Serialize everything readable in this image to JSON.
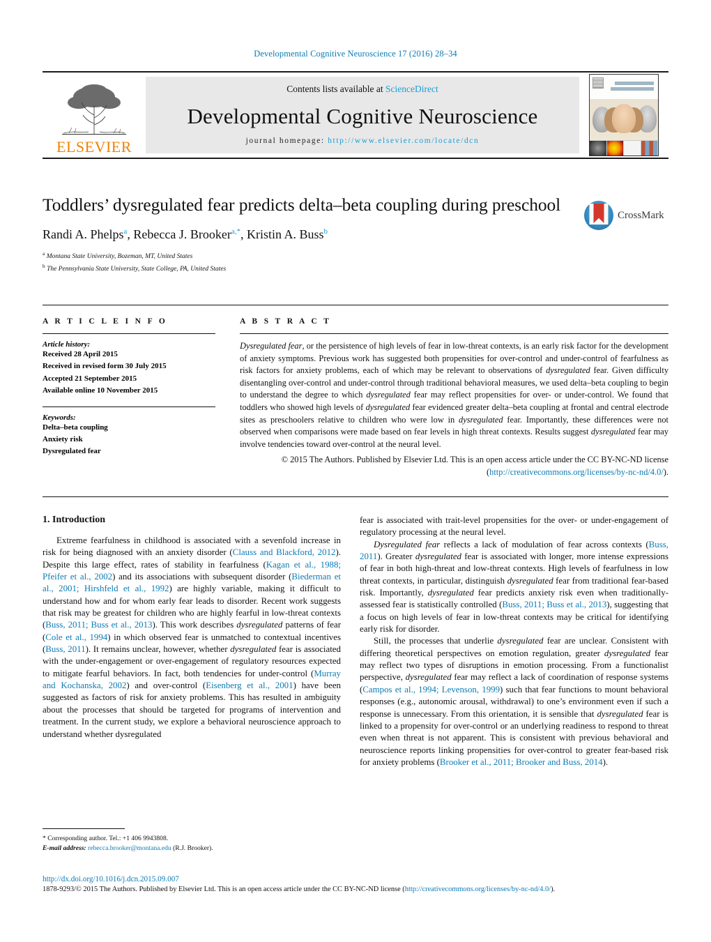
{
  "running_head": "Developmental Cognitive Neuroscience 17 (2016) 28–34",
  "masthead": {
    "publisher_name": "ELSEVIER",
    "contents_prefix": "Contents lists available at ",
    "contents_link": "ScienceDirect",
    "journal_title": "Developmental Cognitive Neuroscience",
    "homepage_prefix": "journal homepage: ",
    "homepage_url": "http://www.elsevier.com/locate/dcn",
    "cover_title_line1": "Developmental",
    "cover_title_line2": "Cognitive Neuroscience"
  },
  "article": {
    "title": "Toddlers’ dysregulated fear predicts delta–beta coupling during preschool",
    "authors_html": "Randi A. Phelps<sup>a</sup>, Rebecca J. Brooker<sup>a,*</sup>, Kristin A. Buss<sup>b</sup>",
    "affiliations": [
      {
        "marker": "a",
        "text": "Montana State University, Bozeman, MT, United States"
      },
      {
        "marker": "b",
        "text": "The Pennsylvania State University, State College, PA, United States"
      }
    ],
    "crossmark_label": "CrossMark"
  },
  "article_info": {
    "kicker": "A R T I C L E   I N F O",
    "history_label": "Article history:",
    "history": [
      "Received 28 April 2015",
      "Received in revised form 30 July 2015",
      "Accepted 21 September 2015",
      "Available online 10 November 2015"
    ],
    "keywords_label": "Keywords:",
    "keywords": [
      "Delta–beta coupling",
      "Anxiety risk",
      "Dysregulated fear"
    ]
  },
  "abstract": {
    "kicker": "A B S T R A C T",
    "text": "Dysregulated fear, or the persistence of high levels of fear in low-threat contexts, is an early risk factor for the development of anxiety symptoms. Previous work has suggested both propensities for over-control and under-control of fearfulness as risk factors for anxiety problems, each of which may be relevant to observations of dysregulated fear. Given difficulty disentangling over-control and under-control through traditional behavioral measures, we used delta–beta coupling to begin to understand the degree to which dysregulated fear may reflect propensities for over- or under-control. We found that toddlers who showed high levels of dysregulated fear evidenced greater delta–beta coupling at frontal and central electrode sites as preschoolers relative to children who were low in dysregulated fear. Importantly, these differences were not observed when comparisons were made based on fear levels in high threat contexts. Results suggest dysregulated fear may involve tendencies toward over-control at the neural level.",
    "copyright_text": "© 2015 The Authors. Published by Elsevier Ltd. This is an open access article under the CC BY-NC-ND license (",
    "copyright_license_url": "http://creativecommons.org/licenses/by-nc-nd/4.0/",
    "copyright_suffix": ")."
  },
  "body": {
    "section_number_title": "1.  Introduction",
    "left_paragraphs": [
      "Extreme fearfulness in childhood is associated with a sevenfold increase in risk for being diagnosed with an anxiety disorder (Clauss and Blackford, 2012). Despite this large effect, rates of stability in fearfulness (Kagan et al., 1988; Pfeifer et al., 2002) and its associations with subsequent disorder (Biederman et al., 2001; Hirshfeld et al., 1992) are highly variable, making it difficult to understand how and for whom early fear leads to disorder. Recent work suggests that risk may be greatest for children who are highly fearful in low-threat contexts (Buss, 2011; Buss et al., 2013). This work describes dysregulated patterns of fear (Cole et al., 1994) in which observed fear is unmatched to contextual incentives (Buss, 2011). It remains unclear, however, whether dysregulated fear is associated with the under-engagement or over-engagement of regulatory resources expected to mitigate fearful behaviors. In fact, both tendencies for under-control (Murray and Kochanska, 2002) and over-control (Eisenberg et al., 2001) have been suggested as factors of risk for anxiety problems. This has resulted in ambiguity about the processes that should be targeted for programs of intervention and treatment. In the current study, we explore a behavioral neuroscience approach to understand whether dysregulated"
    ],
    "right_paragraphs": [
      "fear is associated with trait-level propensities for the over- or under-engagement of regulatory processing at the neural level.",
      "Dysregulated fear reflects a lack of modulation of fear across contexts (Buss, 2011). Greater dysregulated fear is associated with longer, more intense expressions of fear in both high-threat and low-threat contexts. High levels of fearfulness in low threat contexts, in particular, distinguish dysregulated fear from traditional fear-based risk. Importantly, dysregulated fear predicts anxiety risk even when traditionally-assessed fear is statistically controlled (Buss, 2011; Buss et al., 2013), suggesting that a focus on high levels of fear in low-threat contexts may be critical for identifying early risk for disorder.",
      "Still, the processes that underlie dysregulated fear are unclear. Consistent with differing theoretical perspectives on emotion regulation, greater dysregulated fear may reflect two types of disruptions in emotion processing. From a functionalist perspective, dysregulated fear may reflect a lack of coordination of response systems (Campos et al., 1994; Levenson, 1999) such that fear functions to mount behavioral responses (e.g., autonomic arousal, withdrawal) to one’s environment even if such a response is unnecessary. From this orientation, it is sensible that dysregulated fear is linked to a propensity for over-control or an underlying readiness to respond to threat even when threat is not apparent. This is consistent with previous behavioral and neuroscience reports linking propensities for over-control to greater fear-based risk for anxiety problems (Brooker et al., 2011; Brooker and Buss, 2014)."
    ]
  },
  "footnote": {
    "corresponding": "*  Corresponding author. Tel.: +1 406 9943808.",
    "email_label": "E-mail address:",
    "email": "rebecca.brooker@montana.edu",
    "email_suffix": " (R.J. Brooker)."
  },
  "publication_footer": {
    "doi": "http://dx.doi.org/10.1016/j.dcn.2015.09.007",
    "issn_prefix": "1878-9293/© 2015 The Authors. Published by Elsevier Ltd. This is an open access article under the CC BY-NC-ND license (",
    "license_url": "http://creativecommons.org/licenses/by-nc-nd/4.0/",
    "issn_suffix": ")."
  },
  "colors": {
    "link_blue": "#0b7bb5",
    "sciencedirect_blue": "#1a9ed4",
    "elsevier_orange": "#ef8200",
    "band_gray": "#e8e8e8"
  }
}
